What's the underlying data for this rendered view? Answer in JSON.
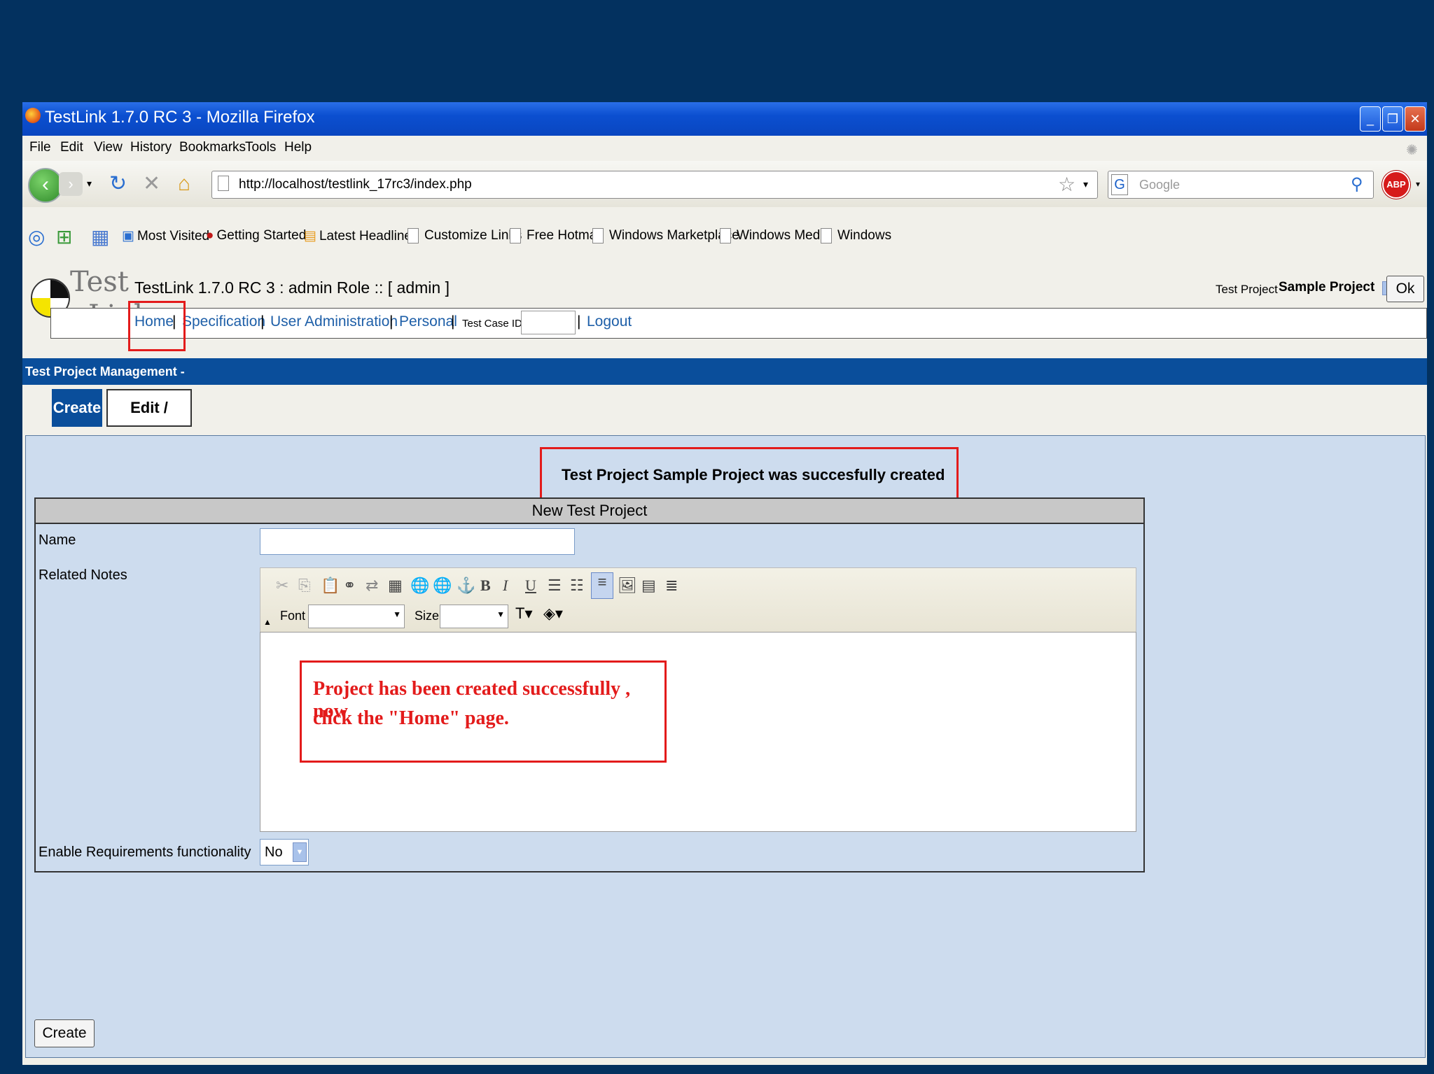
{
  "window": {
    "title": "TestLink 1.7.0 RC 3 - Mozilla Firefox",
    "controls": [
      "minimize",
      "restore",
      "close"
    ]
  },
  "menubar": [
    "File",
    "Edit",
    "View",
    "History",
    "Bookmarks",
    "Tools",
    "Help"
  ],
  "toolbar": {
    "url": "http://localhost/testlink_17rc3/index.php",
    "search_placeholder": "Google",
    "abp_label": "ABP"
  },
  "bookmarks": [
    "Most Visited",
    "Getting Started",
    "Latest Headlines",
    "Customize Links",
    "Free Hotmail",
    "Windows Marketplace",
    "Windows Media",
    "Windows"
  ],
  "testlink": {
    "logo_top": "Test",
    "logo_bottom": "Link",
    "header_title": "TestLink 1.7.0 RC 3 : admin Role :: [ admin ]",
    "test_project_label": "Test Project",
    "test_project_value": "Sample Project",
    "ok_label": "Ok",
    "nav": {
      "home": "Home",
      "specification": "Specification",
      "user_admin": "User Administration",
      "personal": "Personal",
      "test_case_id_label": "Test Case ID:",
      "logout": "Logout",
      "separator": "|"
    }
  },
  "page": {
    "section_title": "Test Project Management -",
    "tabs": [
      "Create",
      "Edit / Delete"
    ],
    "success_message": "Test Project Sample Project was succesfully created",
    "form": {
      "header": "New Test Project",
      "name_label": "Name",
      "name_value": "",
      "notes_label": "Related Notes",
      "font_label": "Font",
      "size_label": "Size",
      "req_label": "Enable Requirements functionality",
      "req_value": "No",
      "create_label": "Create"
    },
    "annotation_line1": "Project has been created successfully , now",
    "annotation_line2": "click the \"Home\" page."
  },
  "colors": {
    "background": "#03315f",
    "titlebar": "#0b4fd0",
    "accent": "#0a4e9b",
    "highlight": "#e31b1b",
    "link": "#1e5fa8"
  }
}
